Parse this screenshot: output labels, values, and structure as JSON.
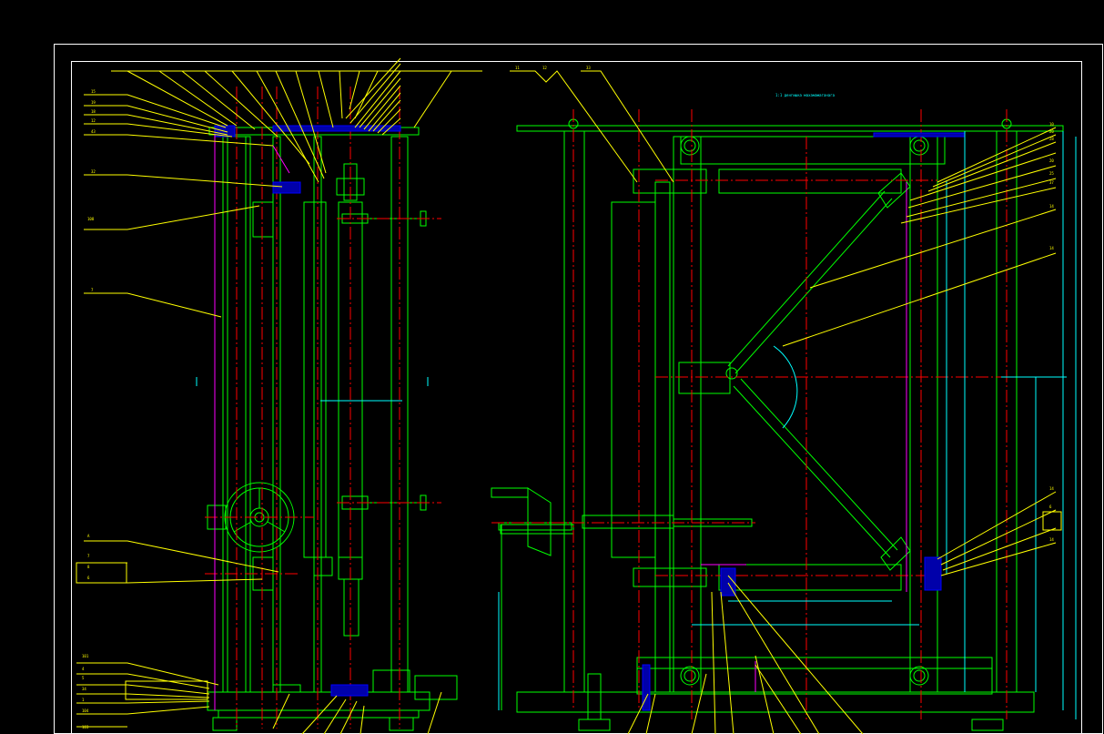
{
  "drawing": {
    "view_title": "1:1 денгишка махамамаганага",
    "colors": {
      "background": "#000000",
      "frame": "#ffffff",
      "outline": "#00ff00",
      "centerline": "#ff0000",
      "leader": "#ffff00",
      "dimension": "#00ffff",
      "hidden": "#ff00ff",
      "part": "#0000ff"
    }
  }
}
